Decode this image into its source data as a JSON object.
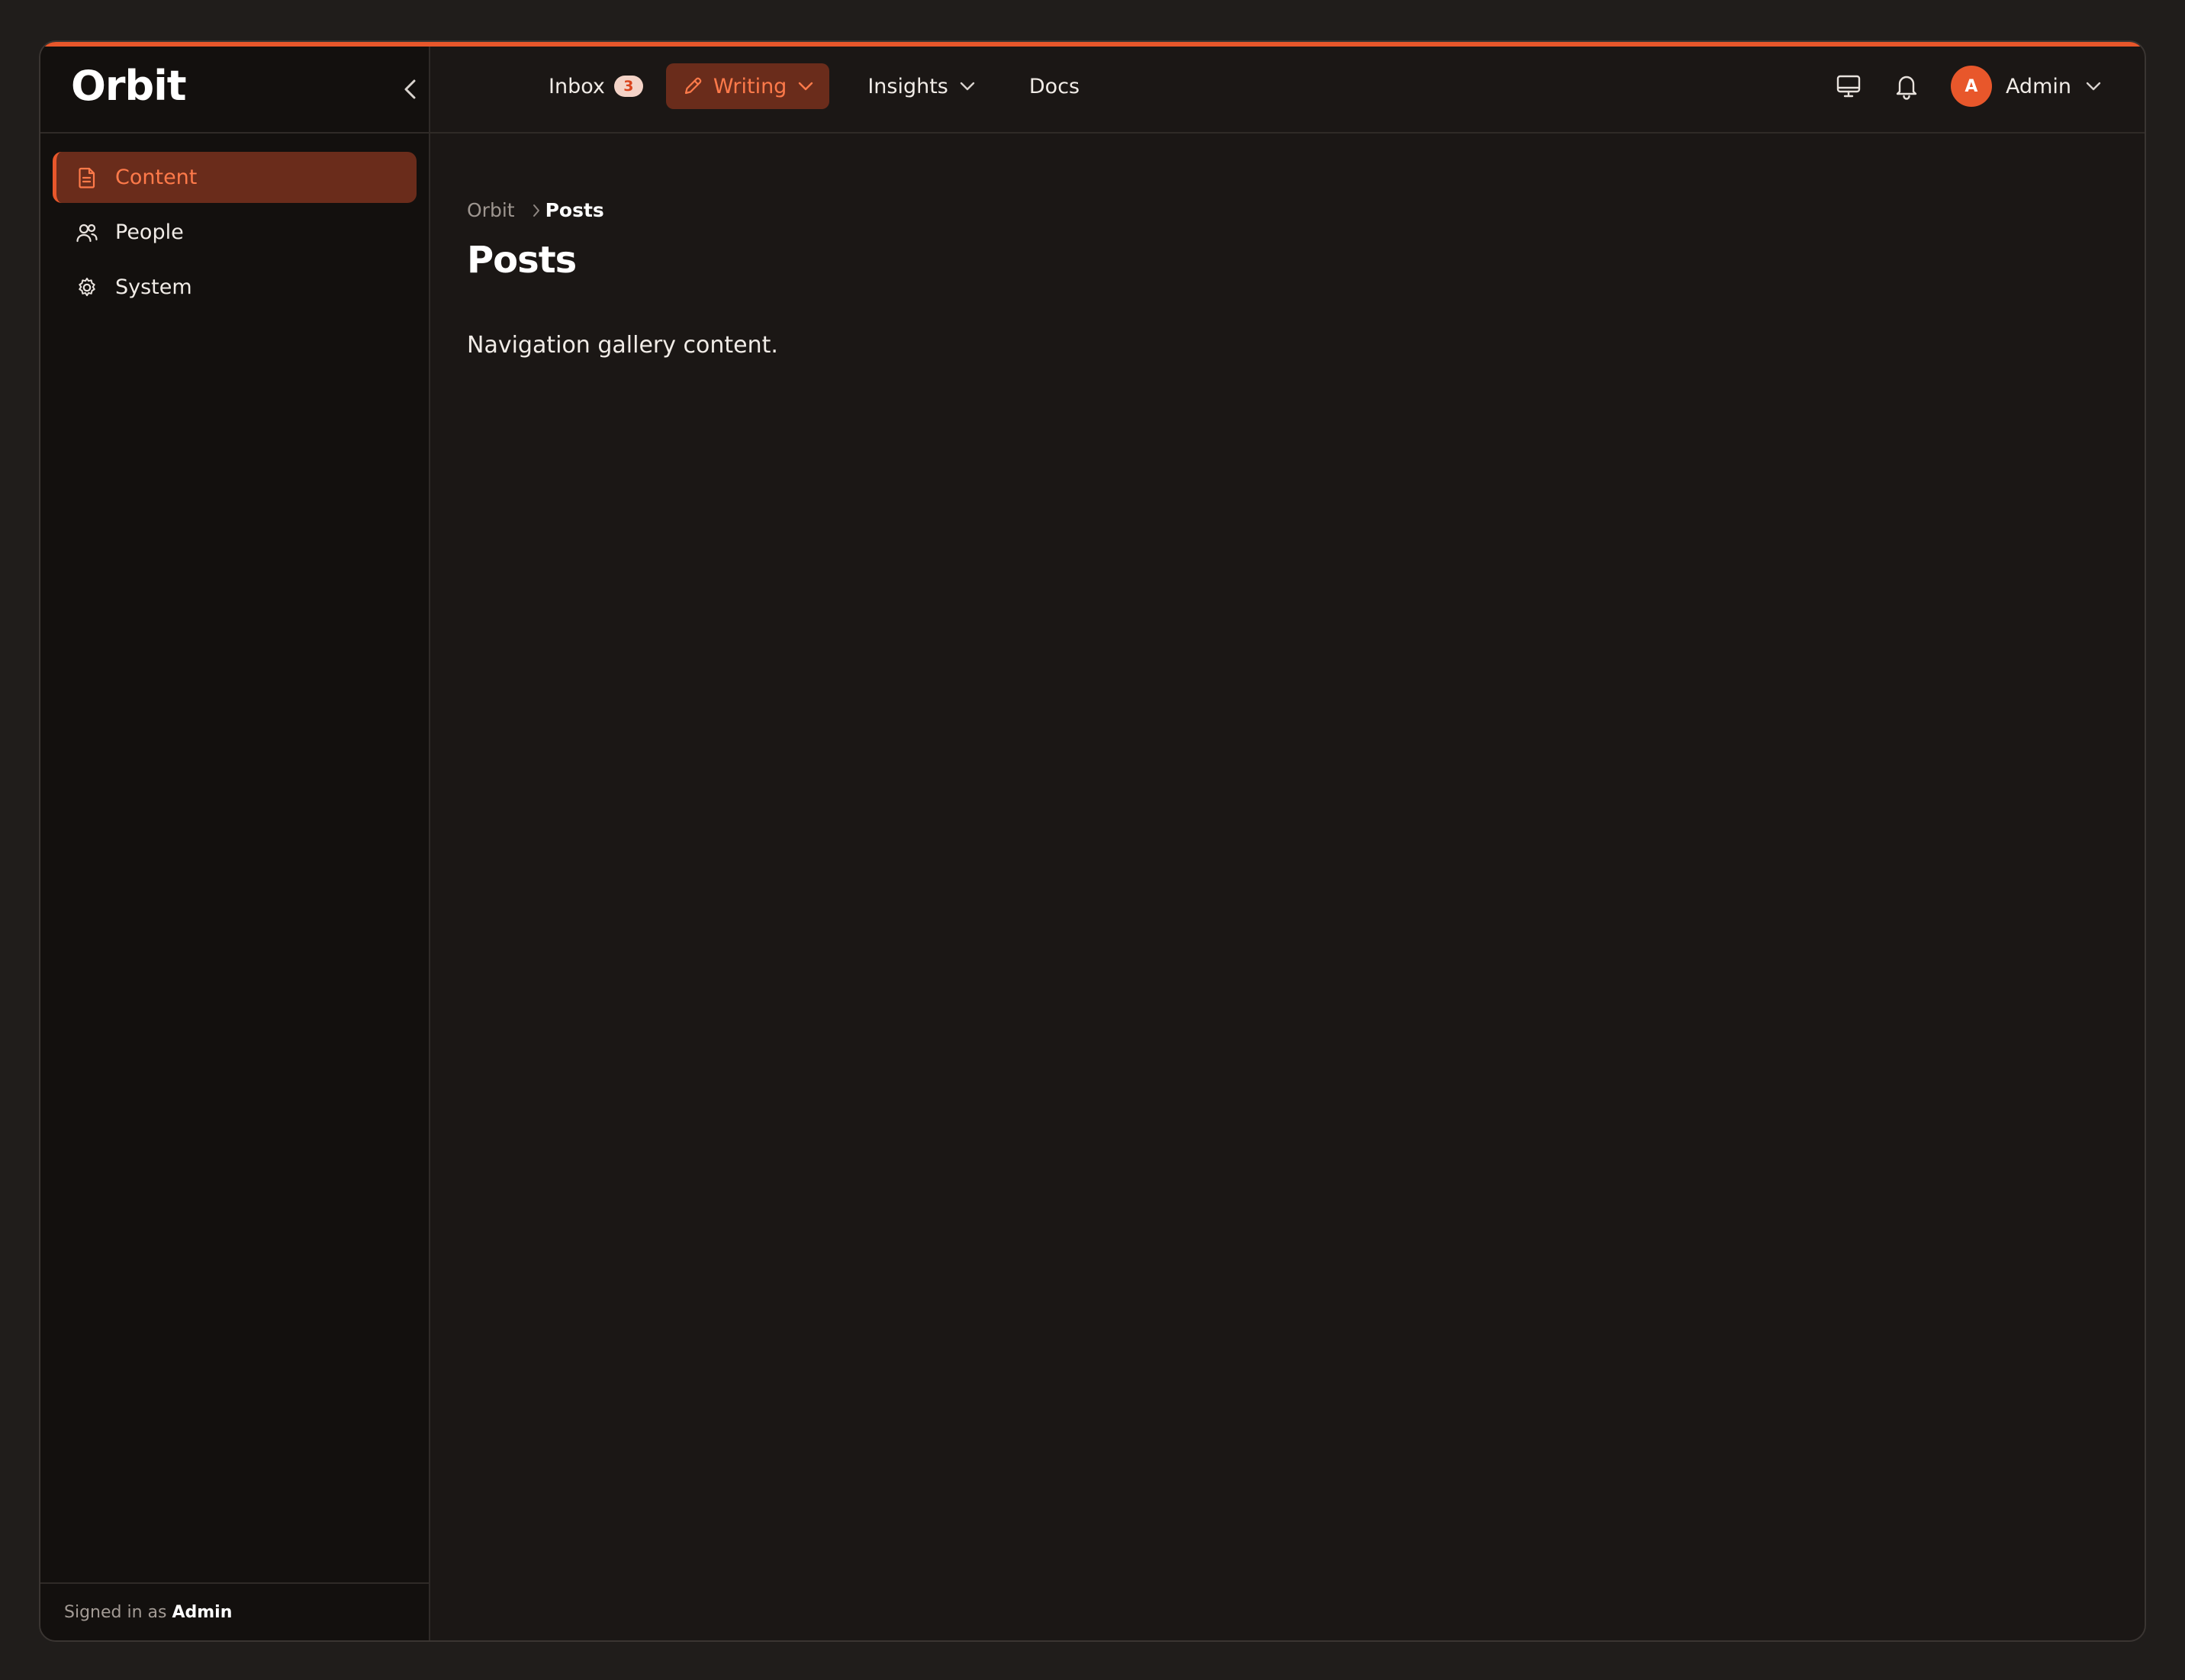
{
  "app": {
    "logo": "Orbit"
  },
  "sidebar": {
    "items": [
      {
        "label": "Content",
        "icon": "document-icon",
        "active": true
      },
      {
        "label": "People",
        "icon": "users-icon",
        "active": false
      },
      {
        "label": "System",
        "icon": "gear-icon",
        "active": false
      }
    ],
    "footer_prefix": "Signed in as",
    "footer_user": "Admin"
  },
  "topnav": {
    "inbox_label": "Inbox",
    "inbox_count": "3",
    "writing_label": "Writing",
    "insights_label": "Insights",
    "docs_label": "Docs"
  },
  "user": {
    "initial": "A",
    "name": "Admin"
  },
  "breadcrumb": {
    "root": "Orbit",
    "current": "Posts"
  },
  "page": {
    "title": "Posts",
    "body": "Navigation gallery content."
  },
  "colors": {
    "accent": "#e8572b",
    "active_bg": "#6a2c1b",
    "active_text": "#ff7a4a",
    "background": "#1b1715",
    "sidebar_bg": "#13100e"
  }
}
